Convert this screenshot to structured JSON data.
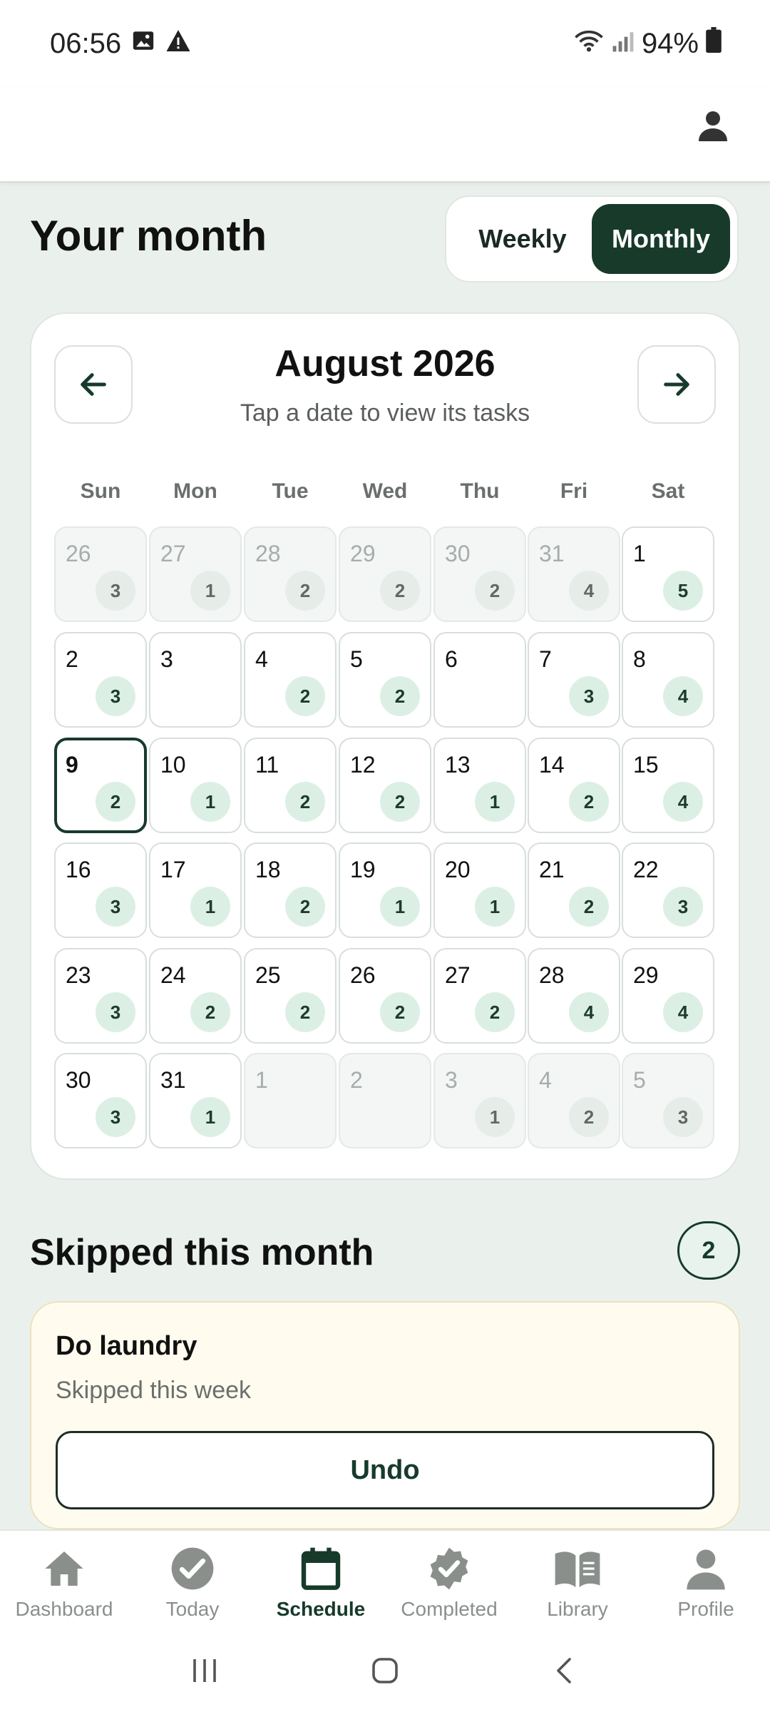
{
  "status_bar": {
    "time": "06:56",
    "battery": "94%"
  },
  "page": {
    "title": "Your month"
  },
  "view_toggle": {
    "weekly": "Weekly",
    "monthly": "Monthly",
    "selected": "Monthly"
  },
  "calendar": {
    "month_title": "August 2026",
    "subtitle": "Tap a date to view its tasks",
    "weekdays": [
      "Sun",
      "Mon",
      "Tue",
      "Wed",
      "Thu",
      "Fri",
      "Sat"
    ],
    "selected_day": "9",
    "weeks": [
      [
        {
          "day": "26",
          "count": "3",
          "outside": true
        },
        {
          "day": "27",
          "count": "1",
          "outside": true
        },
        {
          "day": "28",
          "count": "2",
          "outside": true
        },
        {
          "day": "29",
          "count": "2",
          "outside": true
        },
        {
          "day": "30",
          "count": "2",
          "outside": true
        },
        {
          "day": "31",
          "count": "4",
          "outside": true
        },
        {
          "day": "1",
          "count": "5",
          "outside": false
        }
      ],
      [
        {
          "day": "2",
          "count": "3",
          "outside": false
        },
        {
          "day": "3",
          "count": "",
          "outside": false
        },
        {
          "day": "4",
          "count": "2",
          "outside": false
        },
        {
          "day": "5",
          "count": "2",
          "outside": false
        },
        {
          "day": "6",
          "count": "",
          "outside": false
        },
        {
          "day": "7",
          "count": "3",
          "outside": false
        },
        {
          "day": "8",
          "count": "4",
          "outside": false
        }
      ],
      [
        {
          "day": "9",
          "count": "2",
          "outside": false,
          "selected": true
        },
        {
          "day": "10",
          "count": "1",
          "outside": false
        },
        {
          "day": "11",
          "count": "2",
          "outside": false
        },
        {
          "day": "12",
          "count": "2",
          "outside": false
        },
        {
          "day": "13",
          "count": "1",
          "outside": false
        },
        {
          "day": "14",
          "count": "2",
          "outside": false
        },
        {
          "day": "15",
          "count": "4",
          "outside": false
        }
      ],
      [
        {
          "day": "16",
          "count": "3",
          "outside": false
        },
        {
          "day": "17",
          "count": "1",
          "outside": false
        },
        {
          "day": "18",
          "count": "2",
          "outside": false
        },
        {
          "day": "19",
          "count": "1",
          "outside": false
        },
        {
          "day": "20",
          "count": "1",
          "outside": false
        },
        {
          "day": "21",
          "count": "2",
          "outside": false
        },
        {
          "day": "22",
          "count": "3",
          "outside": false
        }
      ],
      [
        {
          "day": "23",
          "count": "3",
          "outside": false
        },
        {
          "day": "24",
          "count": "2",
          "outside": false
        },
        {
          "day": "25",
          "count": "2",
          "outside": false
        },
        {
          "day": "26",
          "count": "2",
          "outside": false
        },
        {
          "day": "27",
          "count": "2",
          "outside": false
        },
        {
          "day": "28",
          "count": "4",
          "outside": false
        },
        {
          "day": "29",
          "count": "4",
          "outside": false
        }
      ],
      [
        {
          "day": "30",
          "count": "3",
          "outside": false
        },
        {
          "day": "31",
          "count": "1",
          "outside": false
        },
        {
          "day": "1",
          "count": "",
          "outside": true
        },
        {
          "day": "2",
          "count": "",
          "outside": true
        },
        {
          "day": "3",
          "count": "1",
          "outside": true
        },
        {
          "day": "4",
          "count": "2",
          "outside": true
        },
        {
          "day": "5",
          "count": "3",
          "outside": true
        }
      ]
    ]
  },
  "skipped": {
    "title": "Skipped this month",
    "count": "2",
    "items": [
      {
        "task": "Do laundry",
        "note": "Skipped this week",
        "action": "Undo"
      }
    ]
  },
  "bottom_nav": {
    "active": "Schedule",
    "items": [
      {
        "label": "Dashboard",
        "icon": "home-icon"
      },
      {
        "label": "Today",
        "icon": "check-circle-icon"
      },
      {
        "label": "Schedule",
        "icon": "calendar-icon"
      },
      {
        "label": "Completed",
        "icon": "verified-badge-icon"
      },
      {
        "label": "Library",
        "icon": "book-icon"
      },
      {
        "label": "Profile",
        "icon": "person-icon"
      }
    ]
  },
  "colors": {
    "accent": "#173a2b",
    "badge_bg": "#dcefe5",
    "background": "#eaf1ed",
    "skipped_card": "#fffcef"
  }
}
